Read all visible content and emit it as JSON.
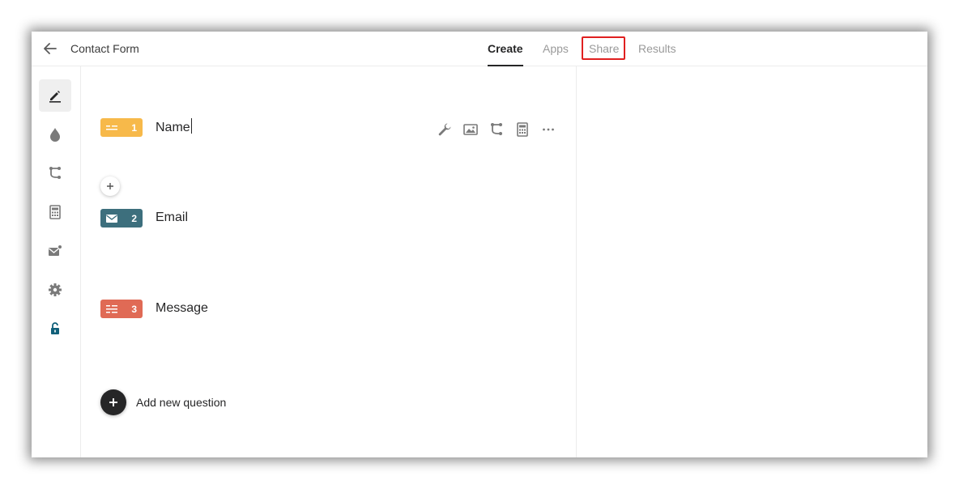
{
  "header": {
    "form_title": "Contact Form",
    "tabs": [
      {
        "label": "Create",
        "active": true
      },
      {
        "label": "Apps",
        "active": false
      },
      {
        "label": "Share",
        "active": false,
        "highlighted": true
      },
      {
        "label": "Results",
        "active": false
      }
    ]
  },
  "sidebar": {
    "items": [
      {
        "icon": "pen-icon",
        "active": true
      },
      {
        "icon": "drop-icon",
        "active": false
      },
      {
        "icon": "logic-branch-icon",
        "active": false
      },
      {
        "icon": "calculator-icon",
        "active": false
      },
      {
        "icon": "mail-notification-icon",
        "active": false
      },
      {
        "icon": "gear-icon",
        "active": false
      },
      {
        "icon": "unlock-icon",
        "active": false
      }
    ]
  },
  "questions": [
    {
      "number": "1",
      "text": "Name",
      "type": "short-text",
      "color": "#f7b94a"
    },
    {
      "number": "2",
      "text": "Email",
      "type": "email",
      "color": "#3d6f7d"
    },
    {
      "number": "3",
      "text": "Message",
      "type": "long-text",
      "color": "#e06a55"
    }
  ],
  "toolbar": {
    "icons": [
      "wrench-icon",
      "image-icon",
      "logic-branch-icon",
      "calculator-icon",
      "more-icon"
    ]
  },
  "add_question": {
    "label": "Add new question"
  },
  "colors": {
    "text_dark": "#262627",
    "tab_inactive": "#9a9a9a",
    "highlight": "#e02020",
    "accent_lock": "#11607a",
    "icon_gray": "#7a7a7a"
  }
}
